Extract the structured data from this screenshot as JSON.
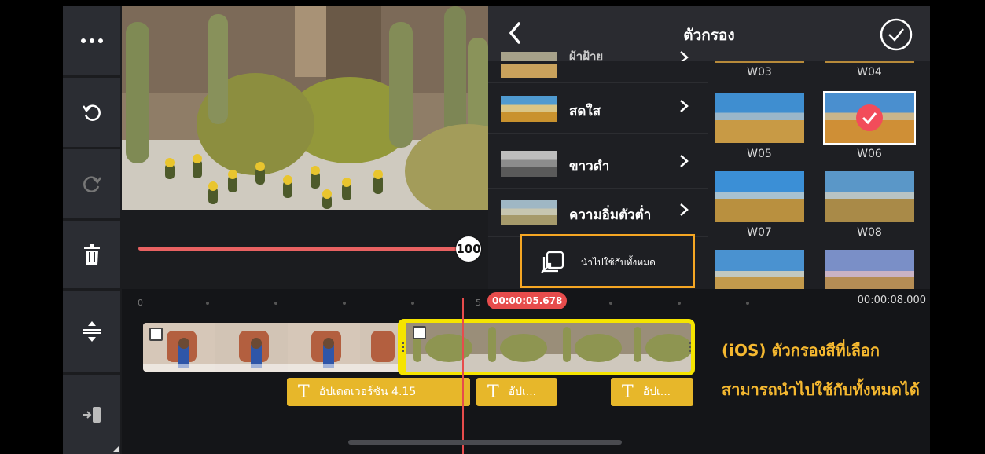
{
  "panel": {
    "title": "ตัวกรอง",
    "categories": [
      {
        "label": "ผ้าฝ้าย"
      },
      {
        "label": "สดใส"
      },
      {
        "label": "ขาวดำ"
      },
      {
        "label": "ความอิ่มตัวต่ำ"
      }
    ],
    "apply_all_label": "นำไปใช้กับทั้งหมด",
    "filters": [
      "W03",
      "W04",
      "W05",
      "W06",
      "W07",
      "W08"
    ],
    "selected_filter": "W06"
  },
  "slider": {
    "value": "100"
  },
  "timeline": {
    "ruler": [
      "0",
      "5"
    ],
    "current_time": "00:00:05.678",
    "end_time": "00:00:08.000",
    "text_clips": [
      "อัปเดตเวอร์ชัน 4.15",
      "อัปเ...",
      "อัปเ..."
    ]
  },
  "annotation": {
    "line1": "(iOS) ตัวกรองสีที่เลือก",
    "line2": "สามารถนำไปใช้กับทั้งหมดได้"
  },
  "colors": {
    "accent": "#f5a623",
    "playhead": "#e74c4c",
    "clip_border": "#f5e400",
    "text_clip": "#e7b72a"
  }
}
